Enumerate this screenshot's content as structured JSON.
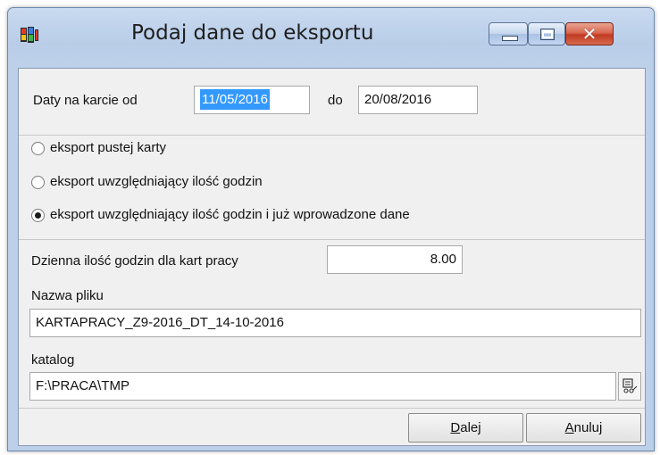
{
  "window": {
    "title": "Podaj dane do eksportu",
    "close_glyph": "✕"
  },
  "dates": {
    "from_label": "Daty na karcie od",
    "from_value": "11/05/2016",
    "to_label": "do",
    "to_value": "20/08/2016"
  },
  "export_options": [
    {
      "label": "eksport pustej karty",
      "checked": false
    },
    {
      "label": "eksport uwzględniający ilość godzin",
      "checked": false
    },
    {
      "label": "eksport uwzględniający ilość godzin i już wprowadzone dane",
      "checked": true
    }
  ],
  "hours": {
    "label": "Dzienna ilość godzin dla  kart pracy",
    "value": "8.00"
  },
  "file": {
    "name_label": "Nazwa pliku",
    "name_value": "KARTAPRACY_Z9-2016_DT_14-10-2016",
    "dir_label": "katalog",
    "dir_value": "F:\\PRACA\\TMP",
    "browse_icon": "folder-browse-icon"
  },
  "buttons": {
    "next_first": "D",
    "next_rest": "alej",
    "cancel_first": "A",
    "cancel_rest": "nuluj"
  }
}
